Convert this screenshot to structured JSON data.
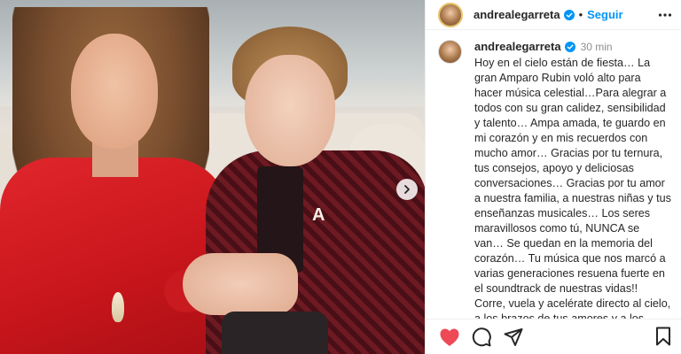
{
  "post": {
    "username": "andrealegarreta",
    "follow_label": "Seguir",
    "separator": "•",
    "time_ago": "30 min",
    "caption": "Hoy en el cielo están de fiesta… La gran Amparo Rubin voló alto para hacer música celestial…Para alegrar a todos con su gran calidez, sensibilidad y talento… Ampa amada, te guardo en mi corazón y en mis recuerdos con mucho amor… Gracias por tu ternura, tus consejos, apoyo y deliciosas conversaciones… Gracias por tu amor a nuestra familia, a nuestras niñas y tus enseñanzas musicales… Los seres maravillosos como tú, NUNCA se van… Se quedan en la memoria del corazón… Tu música que nos marcó a varias generaciones resuena fuerte en el soundtrack de nuestras vidas!! Corre, vuela y acelérate directo al cielo, a los brazos de tus amores y a los brazos De",
    "photo_brooch_letter": "A"
  },
  "icons": {
    "verified": "verified-badge-icon",
    "more": "more-options-icon",
    "next": "chevron-right-icon",
    "like": "heart-icon",
    "comment": "comment-icon",
    "share": "share-icon",
    "save": "bookmark-icon"
  },
  "colors": {
    "like_active": "#ed4956",
    "link_blue": "#0095f6",
    "verified": "#0095f6",
    "text": "#262626",
    "muted": "#8e8e8e"
  }
}
